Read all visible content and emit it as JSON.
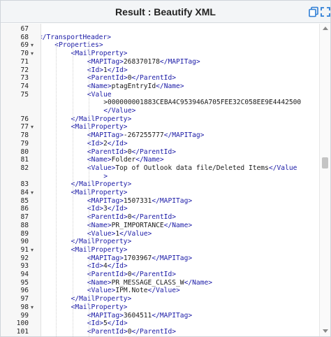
{
  "title": "Result : Beautify XML",
  "colors": {
    "tag": "#1a1aa6",
    "text": "#1a1a1a",
    "titlebar_bg": "#f3f5f7",
    "icon": "#2f7fd6"
  },
  "icons": {
    "copy": "copy-icon",
    "expand": "fullscreen-icon"
  },
  "scrollbar": {
    "position_fraction": 0.44
  },
  "lines": [
    {
      "n": "67",
      "indent": 0,
      "fold": false,
      "tag": "",
      "text": ""
    },
    {
      "n": "68",
      "indent": 0,
      "fold": false,
      "tag": "</TransportHeader>",
      "text": ""
    },
    {
      "n": "69",
      "indent": 1,
      "fold": true,
      "tag": "<Properties>",
      "text": ""
    },
    {
      "n": "70",
      "indent": 2,
      "fold": true,
      "tag": "<MailProperty>",
      "text": ""
    },
    {
      "n": "71",
      "indent": 3,
      "fold": false,
      "tag": "<MAPITag>",
      "text": "268370178",
      "close": "</MAPITag>"
    },
    {
      "n": "72",
      "indent": 3,
      "fold": false,
      "tag": "<Id>",
      "text": "1",
      "close": "</Id>"
    },
    {
      "n": "73",
      "indent": 3,
      "fold": false,
      "tag": "<ParentId>",
      "text": "0",
      "close": "</ParentId>"
    },
    {
      "n": "74",
      "indent": 3,
      "fold": false,
      "tag": "<Name>",
      "text": "ptagEntryId",
      "close": "</Name>"
    },
    {
      "n": "75",
      "indent": 3,
      "fold": false,
      "tag": "<Value",
      "text": ""
    },
    {
      "n": "",
      "indent": 4,
      "fold": false,
      "tag": "",
      "text": ">000000001883CEBA4C953946A705FEE32C058EE9E4442500"
    },
    {
      "n": "",
      "indent": 4,
      "fold": false,
      "tag": "</Value>",
      "text": ""
    },
    {
      "n": "76",
      "indent": 2,
      "fold": false,
      "tag": "</MailProperty>",
      "text": ""
    },
    {
      "n": "77",
      "indent": 2,
      "fold": true,
      "tag": "<MailProperty>",
      "text": ""
    },
    {
      "n": "78",
      "indent": 3,
      "fold": false,
      "tag": "<MAPITag>",
      "text": "-267255777",
      "close": "</MAPITag>"
    },
    {
      "n": "79",
      "indent": 3,
      "fold": false,
      "tag": "<Id>",
      "text": "2",
      "close": "</Id>"
    },
    {
      "n": "80",
      "indent": 3,
      "fold": false,
      "tag": "<ParentId>",
      "text": "0",
      "close": "</ParentId>"
    },
    {
      "n": "81",
      "indent": 3,
      "fold": false,
      "tag": "<Name>",
      "text": "Folder",
      "close": "</Name>"
    },
    {
      "n": "82",
      "indent": 3,
      "fold": false,
      "tag": "<Value>",
      "text": "Top of Outlook data file/Deleted Items",
      "close": "</Value"
    },
    {
      "n": "",
      "indent": 4,
      "fold": false,
      "tag": ">",
      "text": ""
    },
    {
      "n": "83",
      "indent": 2,
      "fold": false,
      "tag": "</MailProperty>",
      "text": ""
    },
    {
      "n": "84",
      "indent": 2,
      "fold": true,
      "tag": "<MailProperty>",
      "text": ""
    },
    {
      "n": "85",
      "indent": 3,
      "fold": false,
      "tag": "<MAPITag>",
      "text": "1507331",
      "close": "</MAPITag>"
    },
    {
      "n": "86",
      "indent": 3,
      "fold": false,
      "tag": "<Id>",
      "text": "3",
      "close": "</Id>"
    },
    {
      "n": "87",
      "indent": 3,
      "fold": false,
      "tag": "<ParentId>",
      "text": "0",
      "close": "</ParentId>"
    },
    {
      "n": "88",
      "indent": 3,
      "fold": false,
      "tag": "<Name>",
      "text": "PR_IMPORTANCE",
      "close": "</Name>"
    },
    {
      "n": "89",
      "indent": 3,
      "fold": false,
      "tag": "<Value>",
      "text": "1",
      "close": "</Value>"
    },
    {
      "n": "90",
      "indent": 2,
      "fold": false,
      "tag": "</MailProperty>",
      "text": ""
    },
    {
      "n": "91",
      "indent": 2,
      "fold": true,
      "tag": "<MailProperty>",
      "text": ""
    },
    {
      "n": "92",
      "indent": 3,
      "fold": false,
      "tag": "<MAPITag>",
      "text": "1703967",
      "close": "</MAPITag>"
    },
    {
      "n": "93",
      "indent": 3,
      "fold": false,
      "tag": "<Id>",
      "text": "4",
      "close": "</Id>"
    },
    {
      "n": "94",
      "indent": 3,
      "fold": false,
      "tag": "<ParentId>",
      "text": "0",
      "close": "</ParentId>"
    },
    {
      "n": "95",
      "indent": 3,
      "fold": false,
      "tag": "<Name>",
      "text": "PR_MESSAGE_CLASS_W",
      "close": "</Name>"
    },
    {
      "n": "96",
      "indent": 3,
      "fold": false,
      "tag": "<Value>",
      "text": "IPM.Note",
      "close": "</Value>"
    },
    {
      "n": "97",
      "indent": 2,
      "fold": false,
      "tag": "</MailProperty>",
      "text": ""
    },
    {
      "n": "98",
      "indent": 2,
      "fold": true,
      "tag": "<MailProperty>",
      "text": ""
    },
    {
      "n": "99",
      "indent": 3,
      "fold": false,
      "tag": "<MAPITag>",
      "text": "3604511",
      "close": "</MAPITag>"
    },
    {
      "n": "100",
      "indent": 3,
      "fold": false,
      "tag": "<Id>",
      "text": "5",
      "close": "</Id>"
    },
    {
      "n": "101",
      "indent": 3,
      "fold": false,
      "tag": "<ParentId>",
      "text": "0",
      "close": "</ParentId>"
    }
  ]
}
